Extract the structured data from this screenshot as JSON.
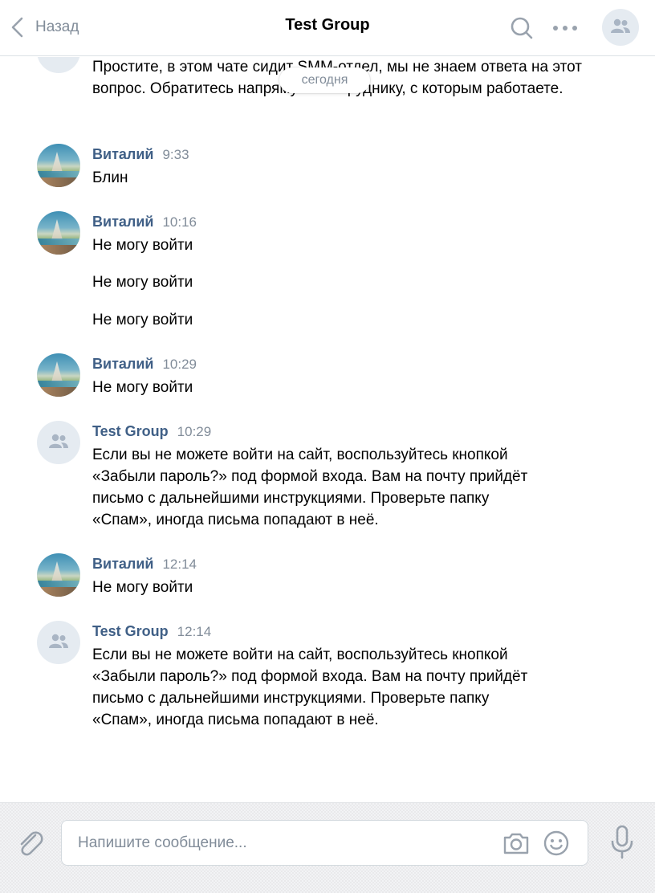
{
  "header": {
    "back_label": "Назад",
    "title": "Test Group",
    "icons": {
      "back": "chevron-left-icon",
      "search": "search-icon",
      "more": "more-dots-icon",
      "avatar": "group-avatar-icon"
    }
  },
  "date_divider": "сегодня",
  "messages": [
    {
      "author": "",
      "time": "",
      "avatar": "group",
      "lines": [
        "Простите, в этом чате сидит SMM-отдел, мы не знаем ответа на этот вопрос. Обратитесь напрямую к сотруднику, с которым работаете."
      ]
    },
    {
      "author": "Виталий",
      "time": "9:33",
      "avatar": "user",
      "lines": [
        "Блин"
      ]
    },
    {
      "author": "Виталий",
      "time": "10:16",
      "avatar": "user",
      "lines": [
        "Не могу войти",
        "Не могу войти",
        "Не могу войти"
      ]
    },
    {
      "author": "Виталий",
      "time": "10:29",
      "avatar": "user",
      "lines": [
        "Не могу войти"
      ]
    },
    {
      "author": "Test Group",
      "time": "10:29",
      "avatar": "group",
      "lines": [
        "Если вы не можете войти на сайт, воспользуйтесь кнопкой\n«Забыли пароль?» под формой входа. Вам на почту прийдёт\nписьмо с дальнейшими инструкциями. Проверьте папку\n«Спам», иногда письма попадают в неё."
      ]
    },
    {
      "author": "Виталий",
      "time": "12:14",
      "avatar": "user",
      "lines": [
        "Не могу войти"
      ]
    },
    {
      "author": "Test Group",
      "time": "12:14",
      "avatar": "group",
      "lines": [
        "Если вы не можете войти на сайт, воспользуйтесь кнопкой\n«Забыли пароль?» под формой входа. Вам на почту прийдёт\nписьмо с дальнейшими инструкциями. Проверьте папку\n«Спам», иногда письма попадают в неё."
      ]
    }
  ],
  "first_message_visible_text": {
    "line1": "Простите, в этом чате сиди",
    "line1_tail": "лел, мы не знаем ответа",
    "line2_head": "на этот вопрос. Обратите",
    "line2_tail": "ю к сотруднику, с которым",
    "line3": "работаете."
  },
  "composer": {
    "placeholder": "Напишите сообщение...",
    "icons": {
      "attach": "paperclip-icon",
      "camera": "camera-icon",
      "emoji": "emoji-icon",
      "mic": "microphone-icon"
    }
  },
  "colors": {
    "accent": "#3f5f86",
    "muted": "#818c99",
    "divider": "#dce1e6"
  }
}
